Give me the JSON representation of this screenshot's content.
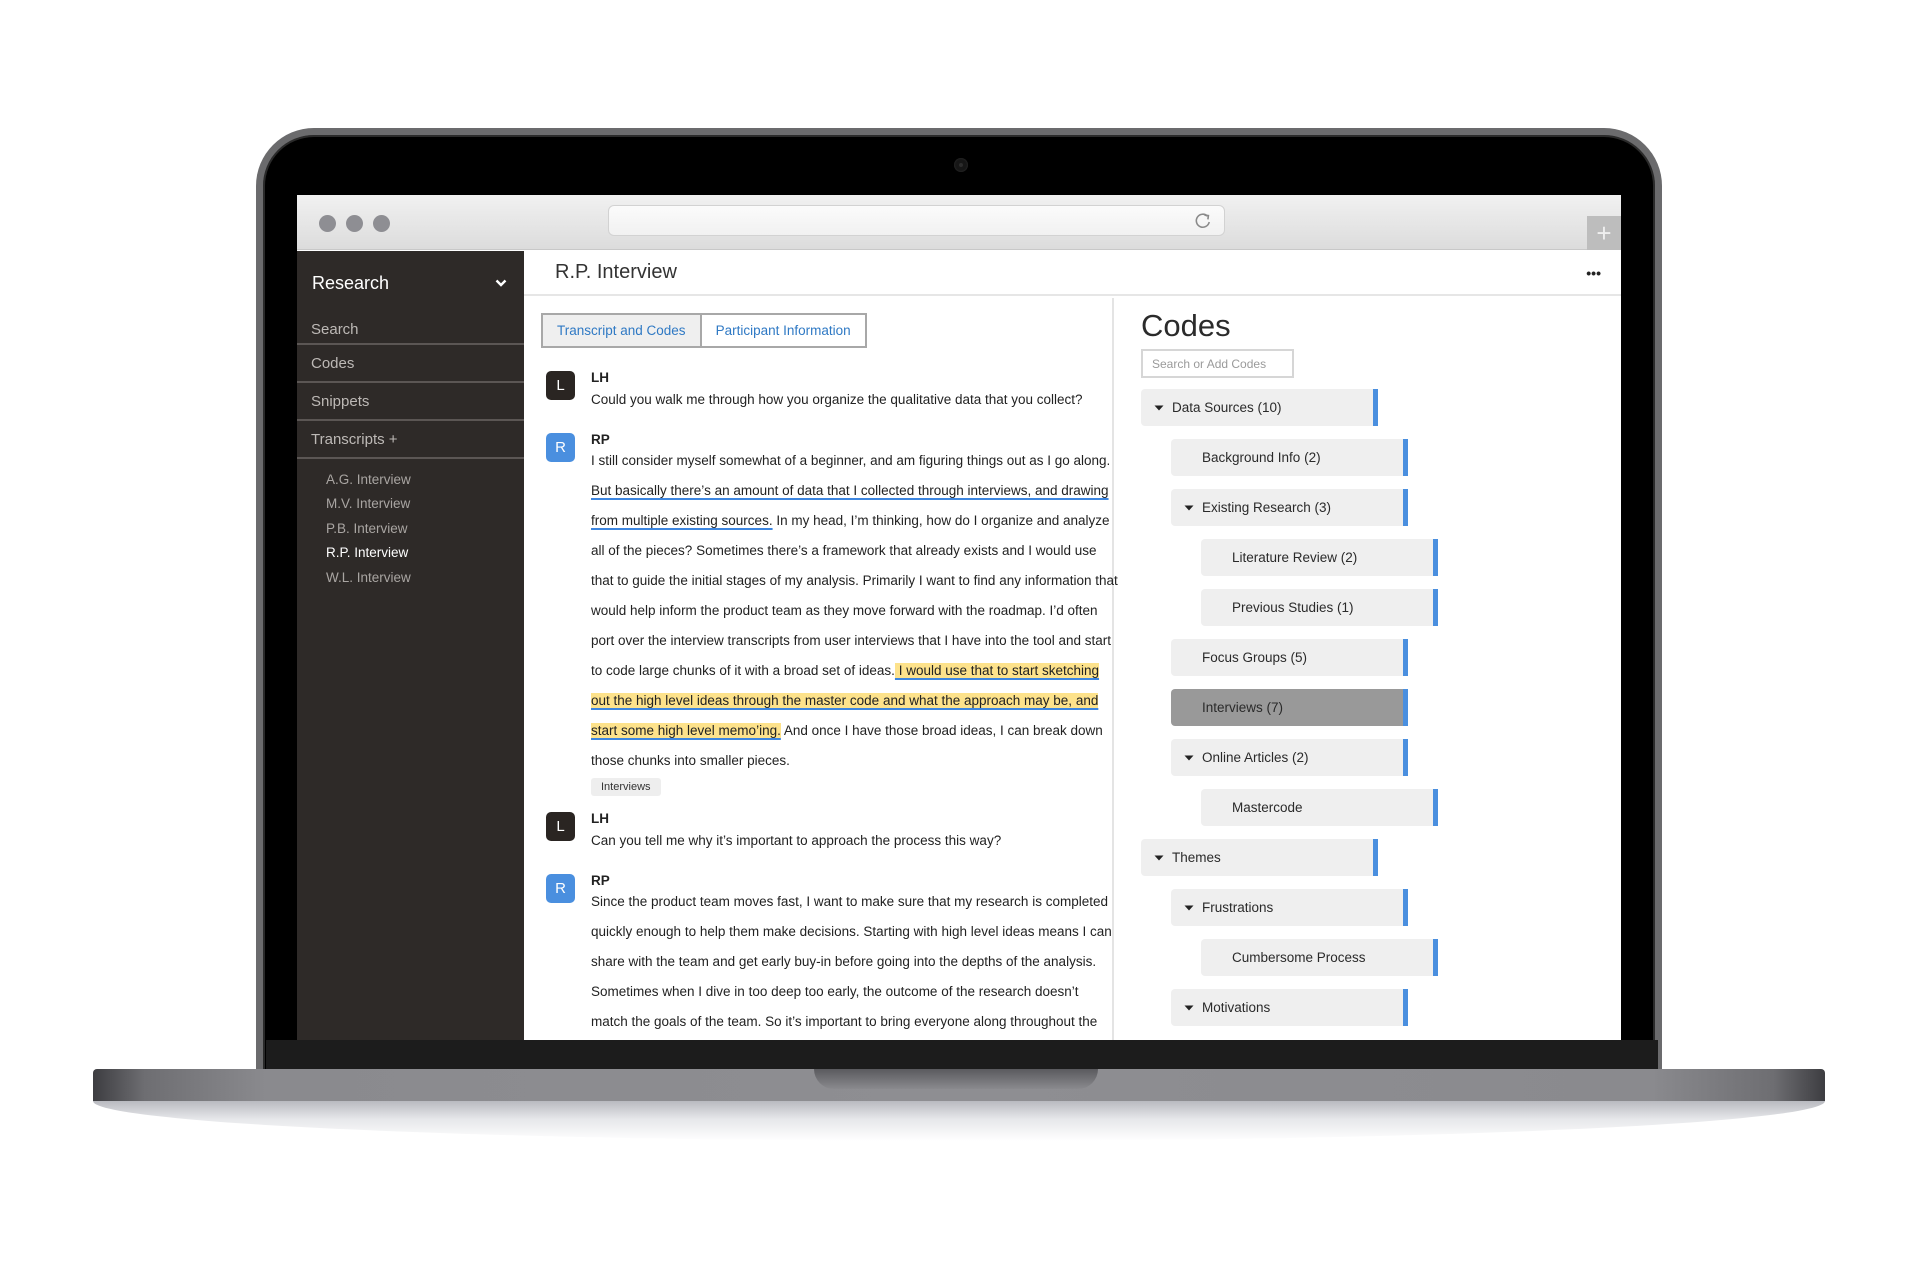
{
  "browser": {
    "address": "",
    "new_tab_label": "+"
  },
  "sidebar": {
    "project": "Research",
    "items": [
      {
        "label": "Search"
      },
      {
        "label": "Codes"
      },
      {
        "label": "Snippets"
      },
      {
        "label": "Transcripts +"
      }
    ],
    "transcripts": [
      {
        "label": "A.G. Interview",
        "active": false
      },
      {
        "label": "M.V. Interview",
        "active": false
      },
      {
        "label": "P.B. Interview",
        "active": false
      },
      {
        "label": "R.P. Interview",
        "active": true
      },
      {
        "label": "W.L. Interview",
        "active": false
      }
    ]
  },
  "main": {
    "title": "R.P. Interview",
    "more_label": "•••",
    "tabs": [
      {
        "label": "Transcript and Codes",
        "active": true
      },
      {
        "label": "Participant Information",
        "active": false
      }
    ]
  },
  "transcript": [
    {
      "avatar": "L",
      "speaker": "LH",
      "text": "Could you walk me through how you organize the qualitative data that you collect?"
    },
    {
      "avatar": "R",
      "speaker": "RP",
      "segments": [
        {
          "text": "I still consider myself somewhat of a beginner, and am figuring things out as I go along.",
          "style": "plain"
        },
        {
          "text": " But basically there’s an amount of data that I collected through interviews, and drawing from multiple existing sources.",
          "style": "coded"
        },
        {
          "text": " In my head, I’m thinking, how do I organize and analyze all of the pieces? Sometimes there’s a framework that already exists and I would use that to guide the initial stages of my analysis. Primarily I want to find any information that would help inform the product team as they move forward with the roadmap. I’d often port over the interview transcripts from user interviews that I have into the tool and start to code large chunks of it with a broad set of ideas.",
          "style": "plain"
        },
        {
          "text": " I would use that to start sketching out the high level ideas through the master code and what the approach may be, and start some high level memo’ing.",
          "style": "highlighted"
        },
        {
          "text": " And once I have those broad ideas, I can break down those chunks into smaller pieces.",
          "style": "plain"
        }
      ],
      "code_chip": "Interviews"
    },
    {
      "avatar": "L",
      "speaker": "LH",
      "text": "Can you tell me why it’s important to approach the process this way?"
    },
    {
      "avatar": "R",
      "speaker": "RP",
      "text": "Since the product team moves fast, I want to make sure that my research is completed quickly enough to help them make decisions. Starting with high level ideas means I can share with the team and get early buy-in before going into the depths of the analysis. Sometimes when I dive in too deep too early, the outcome of the research doesn’t match the goals of the team. So it’s important to bring everyone along throughout the entire process."
    }
  ],
  "codes": {
    "title": "Codes",
    "search_placeholder": "Search or Add Codes",
    "search_value": "",
    "tree": [
      {
        "label": "Data Sources (10)",
        "level": 0,
        "expanded": true,
        "selected": false
      },
      {
        "label": "Background Info (2)",
        "level": 1,
        "expanded": null,
        "selected": false
      },
      {
        "label": "Existing Research (3)",
        "level": 1,
        "expanded": true,
        "selected": false
      },
      {
        "label": "Literature Review (2)",
        "level": 2,
        "expanded": null,
        "selected": false
      },
      {
        "label": "Previous Studies (1)",
        "level": 2,
        "expanded": null,
        "selected": false
      },
      {
        "label": "Focus Groups (5)",
        "level": 1,
        "expanded": null,
        "selected": false
      },
      {
        "label": "Interviews (7)",
        "level": 1,
        "expanded": null,
        "selected": true
      },
      {
        "label": "Online Articles (2)",
        "level": 1,
        "expanded": true,
        "selected": false
      },
      {
        "label": "Mastercode",
        "level": 2,
        "expanded": null,
        "selected": false
      },
      {
        "label": "Themes",
        "level": 0,
        "expanded": true,
        "selected": false
      },
      {
        "label": "Frustrations",
        "level": 1,
        "expanded": true,
        "selected": false
      },
      {
        "label": "Cumbersome Process",
        "level": 2,
        "expanded": null,
        "selected": false
      },
      {
        "label": "Motivations",
        "level": 1,
        "expanded": true,
        "selected": false
      }
    ]
  },
  "colors": {
    "accent_blue": "#4a8fdf",
    "highlight_yellow": "#fde28b",
    "sidebar_bg": "#2e2a28",
    "selected_code_bg": "#999999",
    "tab_text": "#2f79c4"
  }
}
